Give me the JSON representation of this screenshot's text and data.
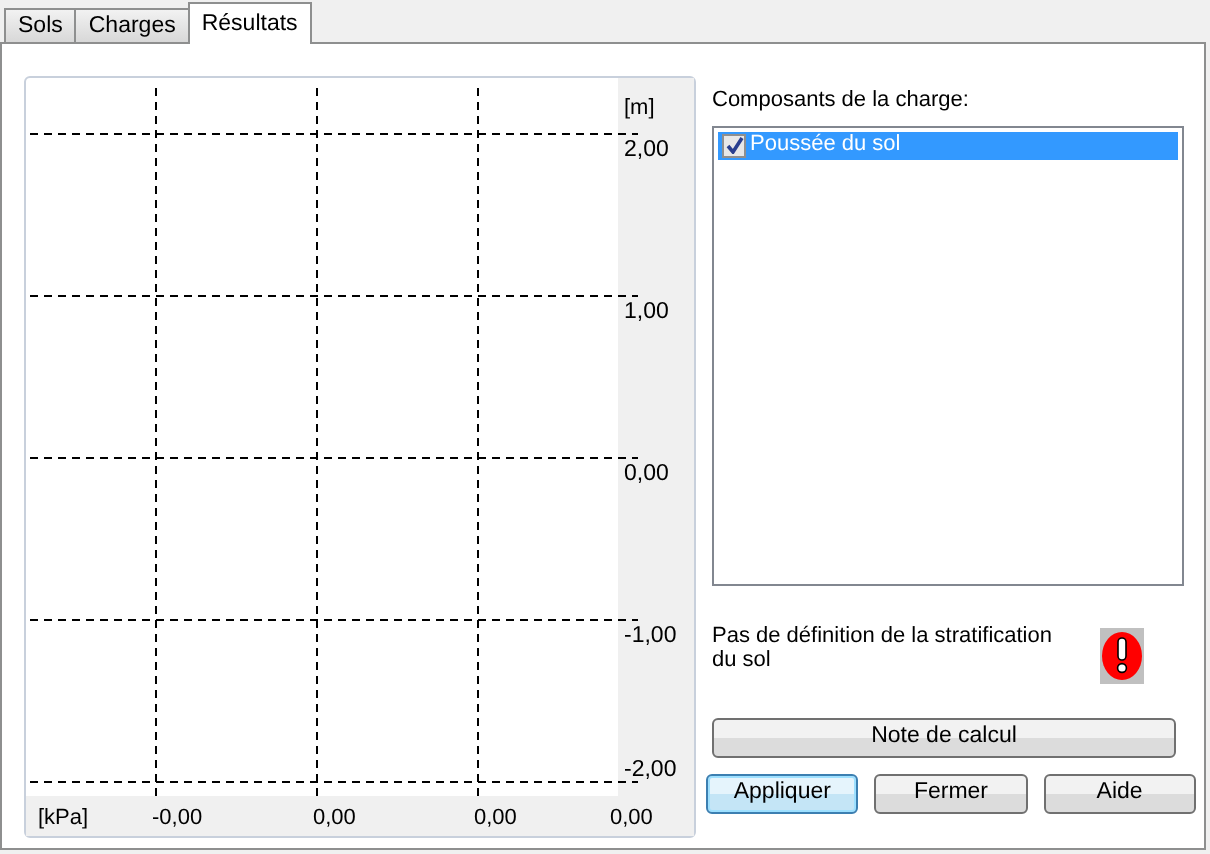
{
  "tabs": [
    {
      "label": "Sols",
      "selected": false
    },
    {
      "label": "Charges",
      "selected": false
    },
    {
      "label": "Résultats",
      "selected": true
    }
  ],
  "plot": {
    "x_axis_label": "[kPa]",
    "y_axis_label": "[m]",
    "x_labels": [
      "-0,00",
      "0,00",
      "0,00",
      "0,00"
    ],
    "y_labels": [
      "2,00",
      "1,00",
      "0,00",
      "-1,00",
      "-2,00"
    ]
  },
  "components": {
    "label": "Composants de la charge:",
    "items": [
      {
        "label": "Poussée du sol",
        "checked": true,
        "selected": true
      }
    ]
  },
  "warning": {
    "text": "Pas de définition de la stratification du sol"
  },
  "buttons": [
    {
      "label": "Note de calcul",
      "kind": "wide",
      "default": false
    },
    {
      "label": "Appliquer",
      "kind": "small",
      "default": true
    },
    {
      "label": "Fermer",
      "kind": "small",
      "default": false
    },
    {
      "label": "Aide",
      "kind": "small",
      "default": false
    }
  ]
}
